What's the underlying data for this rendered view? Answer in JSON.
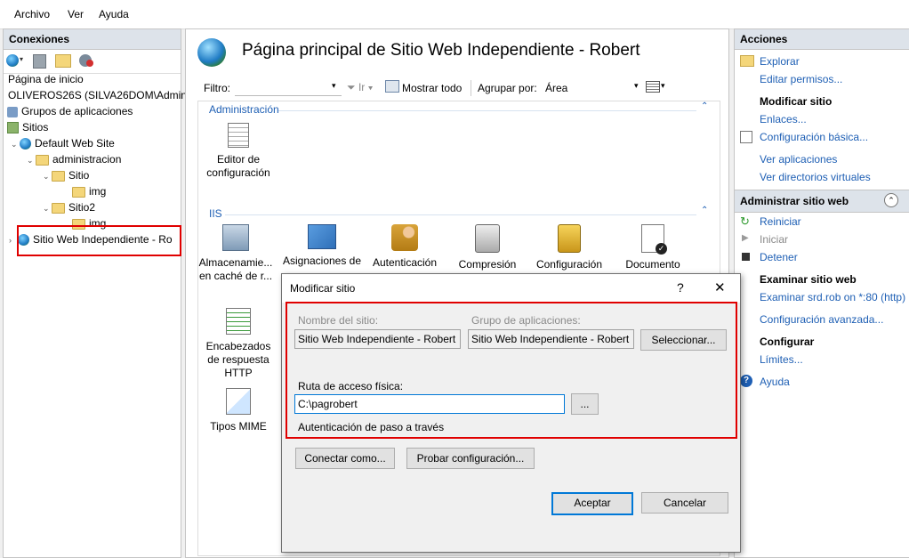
{
  "menu": {
    "items": [
      "Archivo",
      "Ver",
      "Ayuda"
    ]
  },
  "connections": {
    "title": "Conexiones",
    "tree": [
      {
        "label": "Página de inicio"
      },
      {
        "label": "OLIVEROS26S (SILVA26DOM\\Adminis"
      },
      {
        "label": "Grupos de aplicaciones"
      },
      {
        "label": "Sitios"
      },
      {
        "label": "Default Web Site"
      },
      {
        "label": "administracion"
      },
      {
        "label": "Sitio"
      },
      {
        "label": "img"
      },
      {
        "label": "Sitio2"
      },
      {
        "label": "img"
      },
      {
        "label": "Sitio Web Independiente - Ro"
      }
    ]
  },
  "center": {
    "title": "Página principal de Sitio Web Independiente - Robert",
    "filter_label": "Filtro:",
    "go_label": "Ir",
    "show_all_label": "Mostrar todo",
    "group_by_label": "Agrupar por:",
    "group_by_value": "Área",
    "sections": {
      "admin": "Administración",
      "iis": "IIS"
    },
    "features": [
      {
        "label": "Editor de configuración"
      },
      {
        "label": "Almacenamie... en caché de r..."
      },
      {
        "label": "Asignaciones de"
      },
      {
        "label": "Autenticación"
      },
      {
        "label": "Compresión"
      },
      {
        "label": "Configuración"
      },
      {
        "label": "Documento"
      },
      {
        "label": "Encabezados de respuesta HTTP"
      },
      {
        "label": "Tipos MIME"
      }
    ]
  },
  "actions": {
    "title": "Acciones",
    "explore": "Explorar",
    "edit_perms": "Editar permisos...",
    "edit_site_head": "Modificar sitio",
    "bindings": "Enlaces...",
    "basic_settings": "Configuración básica...",
    "view_apps": "Ver aplicaciones",
    "view_vdirs": "Ver directorios virtuales",
    "manage_head": "Administrar sitio web",
    "restart": "Reiniciar",
    "start": "Iniciar",
    "stop": "Detener",
    "browse_head": "Examinar sitio web",
    "browse_link": "Examinar srd.rob on *:80 (http)",
    "advanced": "Configuración avanzada...",
    "configure_head": "Configurar",
    "limits": "Límites...",
    "help": "Ayuda"
  },
  "dialog": {
    "title": "Modificar sitio",
    "help_glyph": "?",
    "close_glyph": "✕",
    "site_name_label": "Nombre del sitio:",
    "site_name_value": "Sitio Web Independiente - Robert",
    "app_pool_label": "Grupo de aplicaciones:",
    "app_pool_value": "Sitio Web Independiente - Robert",
    "select_button": "Seleccionar...",
    "physical_path_label": "Ruta de acceso física:",
    "physical_path_value": "C:\\pagrobert",
    "browse_button": "...",
    "pass_through": "Autenticación de paso a través",
    "connect_as": "Conectar como...",
    "test_settings": "Probar configuración...",
    "ok": "Aceptar",
    "cancel": "Cancelar"
  },
  "colors": {
    "highlight": "#e00000",
    "link": "#1e5fb4",
    "primary_border": "#0078d7"
  }
}
